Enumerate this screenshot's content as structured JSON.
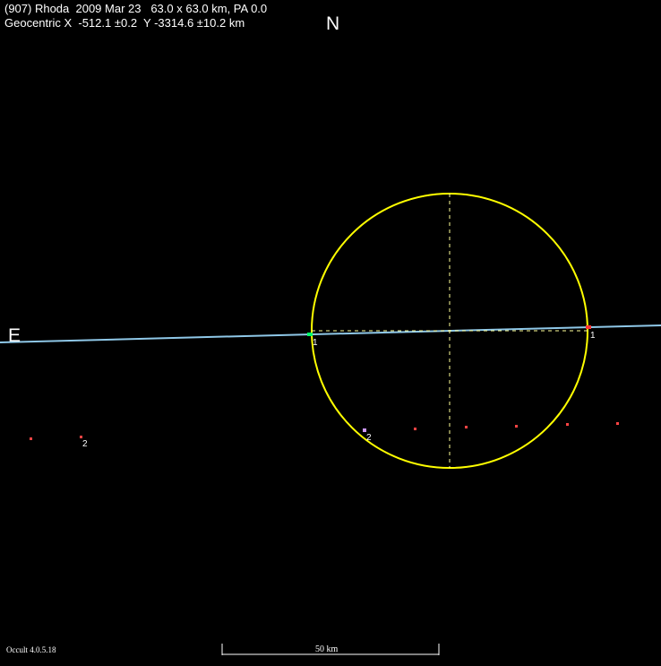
{
  "header": {
    "line1": "(907) Rhoda  2009 Mar 23   63.0 x 63.0 km, PA 0.0",
    "line2": "Geocentric X  -512.1 ±0.2  Y -3314.6 ±10.2 km"
  },
  "compass": {
    "north": "N",
    "east": "E"
  },
  "footer": {
    "version": "Occult 4.0.5.18",
    "scale_label": "50 km"
  },
  "diagram": {
    "ellipse_major_km": 63.0,
    "ellipse_minor_km": 63.0,
    "position_angle_deg": 0.0,
    "observers": [
      {
        "id": "1",
        "type": "positive chord"
      },
      {
        "id": "2",
        "type": "miss"
      }
    ],
    "marker_labels": {
      "chord_west": "1",
      "chord_east": "1",
      "miss_main": "2",
      "miss_far": "2"
    }
  },
  "colors": {
    "background": "#000000",
    "text": "#ffffff",
    "ellipse": "#ffff00",
    "axes": "#ffff99",
    "chord": "#8fc8e8",
    "disappear_marker": "#00ff66",
    "reappear_marker": "#ff3333",
    "miss_marker": "#ff4444",
    "miss_primary_marker": "#cc99ff"
  }
}
